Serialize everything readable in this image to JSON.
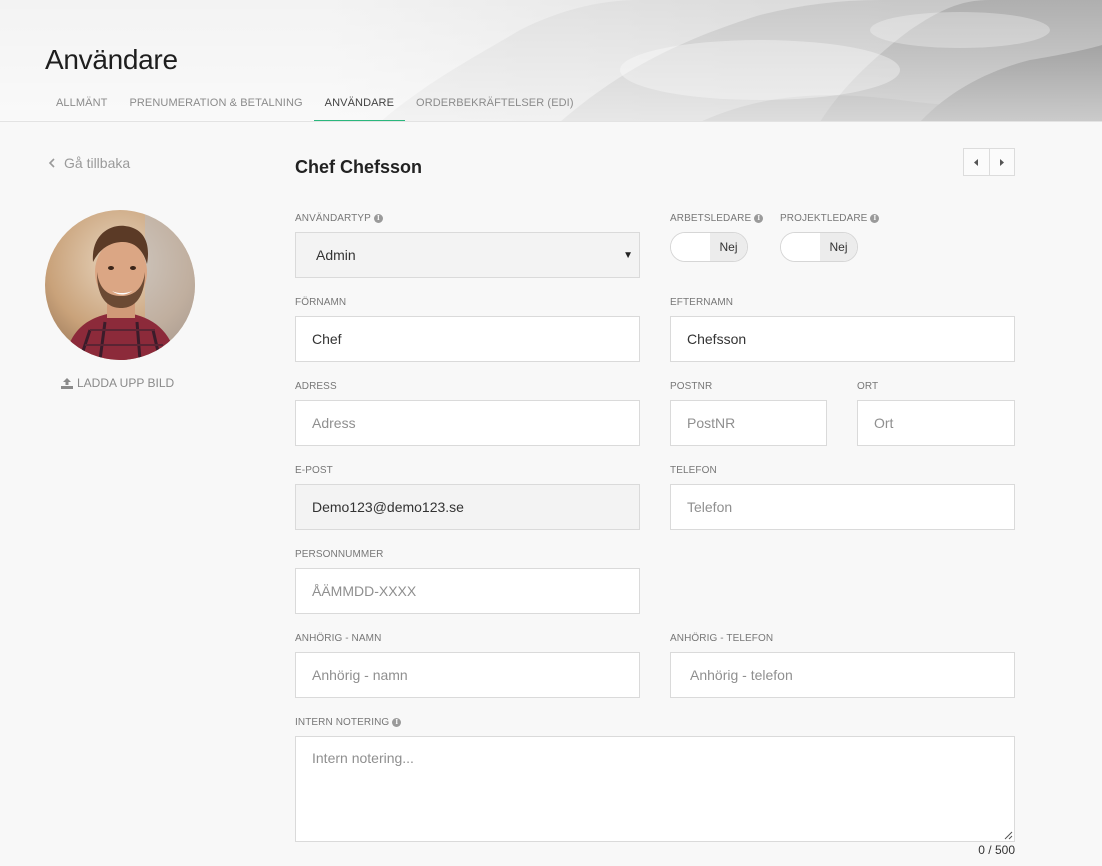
{
  "page": {
    "title": "Användare"
  },
  "tabs": [
    {
      "label": "ALLMÄNT"
    },
    {
      "label": "PRENUMERATION & BETALNING"
    },
    {
      "label": "ANVÄNDARE"
    },
    {
      "label": "ORDERBEKRÄFTELSER (EDI)"
    }
  ],
  "active_tab": "ANVÄNDARE",
  "sidebar": {
    "back_label": "Gå tillbaka",
    "upload_label": "LADDA UPP BILD"
  },
  "user": {
    "name": "Chef Chefsson"
  },
  "form": {
    "user_type": {
      "label": "ANVÄNDARTYP",
      "value": "Admin"
    },
    "foreman": {
      "label": "ARBETSLEDARE",
      "value": "Nej"
    },
    "project_lead": {
      "label": "PROJEKTLEDARE",
      "value": "Nej"
    },
    "first_name": {
      "label": "FÖRNAMN",
      "value": "Chef",
      "placeholder": ""
    },
    "last_name": {
      "label": "EFTERNAMN",
      "value": "Chefsson",
      "placeholder": ""
    },
    "address": {
      "label": "ADRESS",
      "value": "",
      "placeholder": "Adress"
    },
    "postal_code": {
      "label": "POSTNR",
      "value": "",
      "placeholder": "PostNR"
    },
    "city": {
      "label": "ORT",
      "value": "",
      "placeholder": "Ort"
    },
    "email": {
      "label": "E-POST",
      "value": "Demo123@demo123.se"
    },
    "phone": {
      "label": "TELEFON",
      "value": "",
      "placeholder": "Telefon"
    },
    "personal_number": {
      "label": "PERSONNUMMER",
      "value": "",
      "placeholder": "ÅÄMMDD-XXXX"
    },
    "relative_name": {
      "label": "ANHÖRIG - NAMN",
      "value": "",
      "placeholder": "Anhörig - namn"
    },
    "relative_phone": {
      "label": "ANHÖRIG - TELEFON",
      "value": "",
      "placeholder": "Anhörig - telefon"
    },
    "internal_note": {
      "label": "INTERN NOTERING",
      "value": "",
      "placeholder": "Intern notering...",
      "counter": "0 / 500"
    }
  },
  "colors": {
    "accent": "#2ab77d",
    "background": "#f8f8f8",
    "field_border": "#dadada",
    "disabled_field": "#f3f3f3"
  },
  "icons": [
    "chevron-left-icon",
    "upload-icon",
    "info-icon",
    "caret-down-icon",
    "caret-left-icon",
    "caret-right-icon",
    "resize-handle-icon"
  ]
}
